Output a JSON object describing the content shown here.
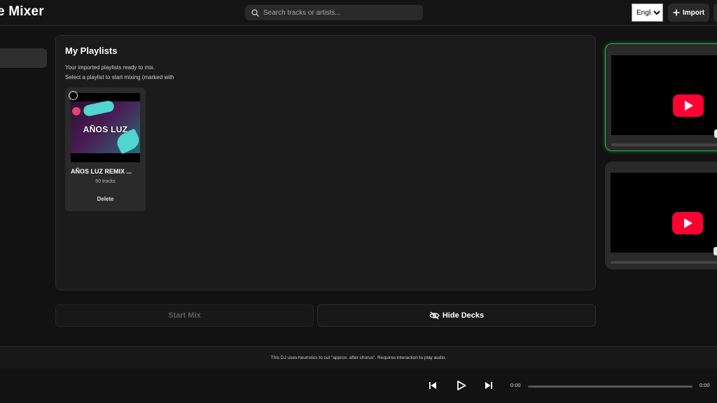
{
  "header": {
    "brand": "e Mixer",
    "search_placeholder": "Search tracks or artists...",
    "language_selected": "English",
    "import_label": "Import"
  },
  "playlists_panel": {
    "title": "My Playlists",
    "subtitle_line1": "Your imported playlists ready to mix.",
    "subtitle_line2": "Select a playlist to start mixing (marked with",
    "cards": [
      {
        "name": "AÑOS LUZ REMIX ...",
        "artwork_text": "AÑOS LUZ",
        "tracks": "50 tracks",
        "delete_label": "Delete"
      }
    ]
  },
  "actions": {
    "start_mix": "Start Mix",
    "hide_decks": "Hide Decks"
  },
  "decks": [
    {
      "video": "youtube-placeholder",
      "active": true
    },
    {
      "video": "youtube-placeholder",
      "active": false
    }
  ],
  "footer": {
    "note": "This DJ uses heuristics to cut \"approx. after chorus\". Requires interaction to play audio."
  },
  "player": {
    "current_time": "0:00",
    "total_time": "0:00",
    "progress": 0
  },
  "colors": {
    "background": "#121212",
    "accent_active_deck": "#27b44f",
    "youtube_red": "#ff0033"
  }
}
